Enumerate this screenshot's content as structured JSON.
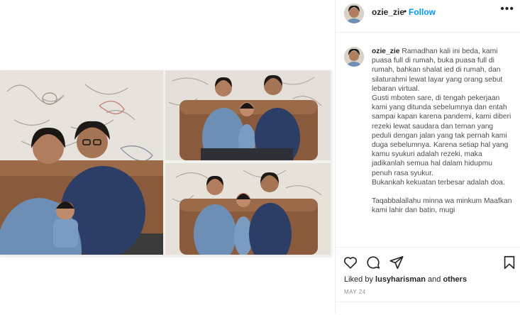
{
  "post": {
    "username": "ozie_zie",
    "dot": "•",
    "follow_label": "Follow",
    "more_label": "•••"
  },
  "caption": {
    "username": "ozie_zie",
    "lines": [
      "Ramadhan kali ini beda, kami puasa full di rumah, buka puasa full di rumah, bahkan shalat ied di rumah, dan silaturahmi lewat layar yang orang sebut lebaran virtual.",
      "Gusti mboten sare, di tengah pekerjaan kami yang ditunda sebelumnya dan entah sampai kapan karena pandemi, kami diberi rezeki lewat saudara dan teman yang peduli dengan jalan yang tak pernah kami duga sebelumnya. Karena setiap hal yang kamu syukuri adalah rezeki, maka jadikanlah semua hal dalam hidupmu penuh rasa syukur.",
      "Bukankah kekuatan terbesar adalah doa."
    ],
    "closing": "Taqabbalallahu minna wa minkum Maafkan kami lahir dan batin, mugi"
  },
  "engagement": {
    "liked_prefix": "Liked by",
    "liked_user": "lusyharisman",
    "liked_and": "and",
    "liked_others": "others",
    "date": "MAY 24"
  },
  "icons": {
    "like": "heart-icon",
    "comment": "comment-icon",
    "share": "share-icon",
    "save": "bookmark-icon"
  },
  "colors": {
    "accent": "#0095f6",
    "sofa": "#8a5a3c",
    "wall": "#e7e3dc",
    "denim": "#6d8fb6",
    "navy": "#2d3e66"
  }
}
